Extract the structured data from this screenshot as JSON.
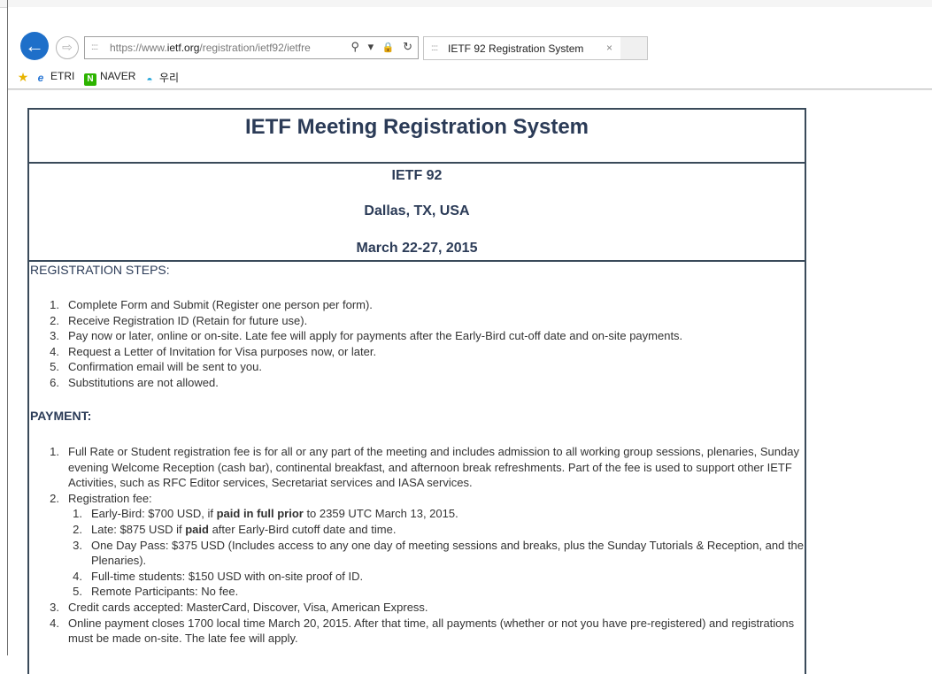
{
  "browser": {
    "address_url_dim": "https://www.",
    "address_url_host": "ietf.org",
    "address_url_path": "/registration/ietf92/ietfre",
    "search_glyph": "⚲",
    "dropdown_glyph": "▾",
    "lock_glyph": "🔒",
    "refresh_glyph": "↻",
    "tab_label": "IETF 92 Registration System",
    "tab_close": "×"
  },
  "favorites": [
    {
      "label": "ETRI"
    },
    {
      "label": "NAVER"
    },
    {
      "label": "우리"
    }
  ],
  "page": {
    "title": "IETF Meeting Registration System",
    "meeting": "IETF 92",
    "location": "Dallas, TX, USA",
    "dates": "March 22-27, 2015",
    "steps_heading": "REGISTRATION STEPS:",
    "steps": [
      "Complete Form and Submit (Register one person per form).",
      "Receive Registration ID (Retain for future use).",
      "Pay now or later, online or on-site. Late fee will apply for payments after the Early-Bird cut-off date and on-site payments.",
      "Request a Letter of Invitation for Visa purposes now, or later.",
      "Confirmation email will be sent to you.",
      "Substitutions are not allowed."
    ],
    "payment_heading": "PAYMENT:",
    "payment_1": "Full Rate or Student registration fee is for all or any part of the meeting and includes admission to all working group sessions, plenaries, Sunday evening Welcome Reception (cash bar), continental breakfast, and afternoon break refreshments. Part of the fee is used to support other IETF Activities, such as RFC Editor services, Secretariat services and IASA services.",
    "payment_2": "Registration fee:",
    "fee_1_a": "Early-Bird: $700 USD, if ",
    "fee_1_b": "paid in full prior",
    "fee_1_c": " to 2359 UTC March 13, 2015.",
    "fee_2_a": "Late: $875 USD if ",
    "fee_2_b": "paid",
    "fee_2_c": " after Early-Bird cutoff date and time.",
    "fee_3": "One Day Pass: $375 USD (Includes access to any one day of meeting sessions and breaks, plus the Sunday Tutorials & Reception, and the Plenaries).",
    "fee_4": "Full-time students: $150 USD with on-site proof of ID.",
    "fee_5": "Remote Participants: No fee.",
    "payment_3": "Credit cards accepted: MasterCard, Discover, Visa, American Express.",
    "payment_4": "Online payment closes 1700 local time March 20, 2015. After that time, all payments (whether or not you have pre-registered) and registrations must be made on-site. The late fee will apply."
  }
}
